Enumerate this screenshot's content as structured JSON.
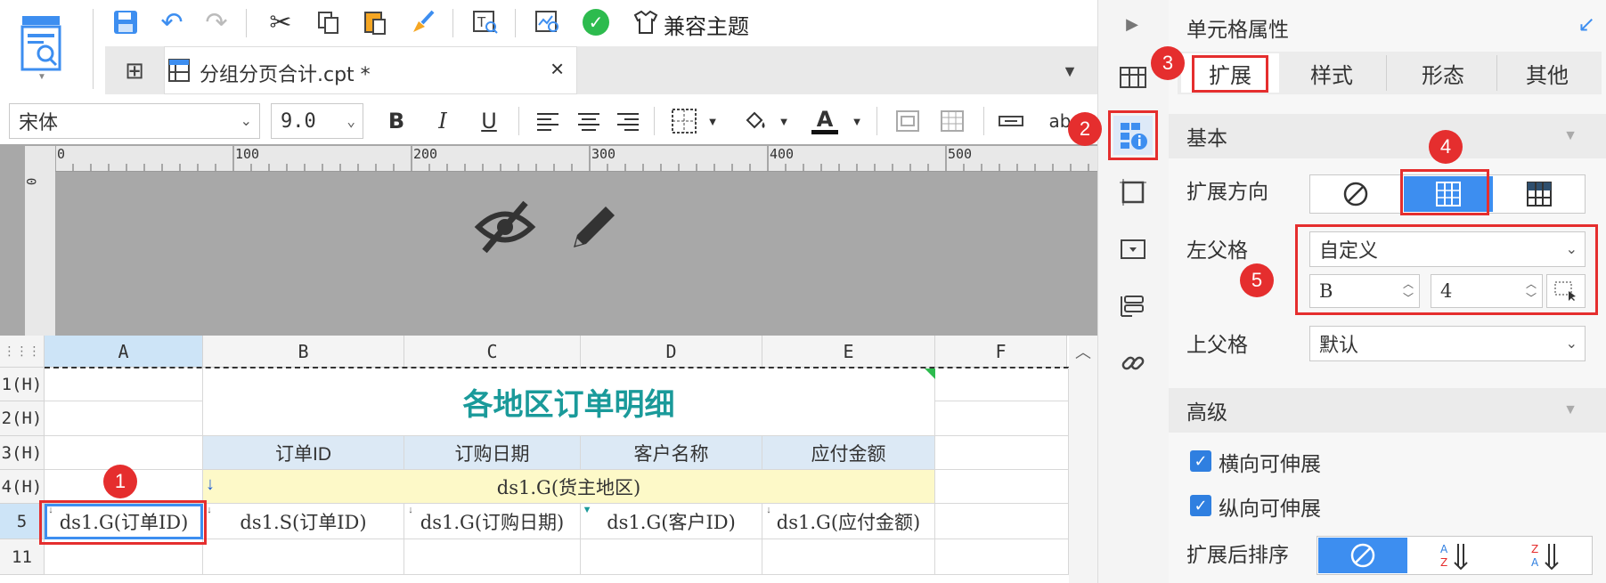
{
  "toolbar": {
    "theme_label": "兼容主题"
  },
  "tab": {
    "file_name": "分组分页合计.cpt *",
    "close": "×"
  },
  "format": {
    "font": "宋体",
    "size": "9.0",
    "bold": "B",
    "italic": "I",
    "underline": "U",
    "font_color_letter": "A",
    "abc": "ab"
  },
  "ruler": {
    "ticks": [
      "0",
      "100",
      "200",
      "300",
      "400",
      "500"
    ],
    "left_tick": "0"
  },
  "grid": {
    "columns": [
      "A",
      "B",
      "C",
      "D",
      "E",
      "F"
    ],
    "rows": [
      "1(H)",
      "2(H)",
      "3(H)",
      "4(H)",
      "5",
      "11"
    ],
    "title": "各地区订单明细",
    "headers": [
      "订单ID",
      "订购日期",
      "客户名称",
      "应付金额"
    ],
    "group_cell": "ds1.G(货主地区)",
    "row5": [
      "ds1.G(订单ID)",
      "ds1.S(订单ID)",
      "ds1.G(订购日期)",
      "ds1.G(客户ID)",
      "ds1.G(应付金额)"
    ]
  },
  "panel": {
    "title": "单元格属性",
    "tabs": [
      "扩展",
      "样式",
      "形态",
      "其他"
    ],
    "section_basic": "基本",
    "expand_direction_label": "扩展方向",
    "left_parent_label": "左父格",
    "left_parent_value": "自定义",
    "left_parent_col": "B",
    "left_parent_row": "4",
    "top_parent_label": "上父格",
    "top_parent_value": "默认",
    "section_advanced": "高级",
    "horizontal_extendable": "横向可伸展",
    "vertical_extendable": "纵向可伸展",
    "sort_after_expand": "扩展后排序"
  },
  "badges": [
    "1",
    "2",
    "3",
    "4",
    "5"
  ],
  "colors": {
    "accent": "#3d8ef0",
    "badge": "#e52e2e",
    "title_teal": "#1a9a9a",
    "header_blue": "#dce9f5",
    "group_yellow": "#fdf9c8"
  }
}
